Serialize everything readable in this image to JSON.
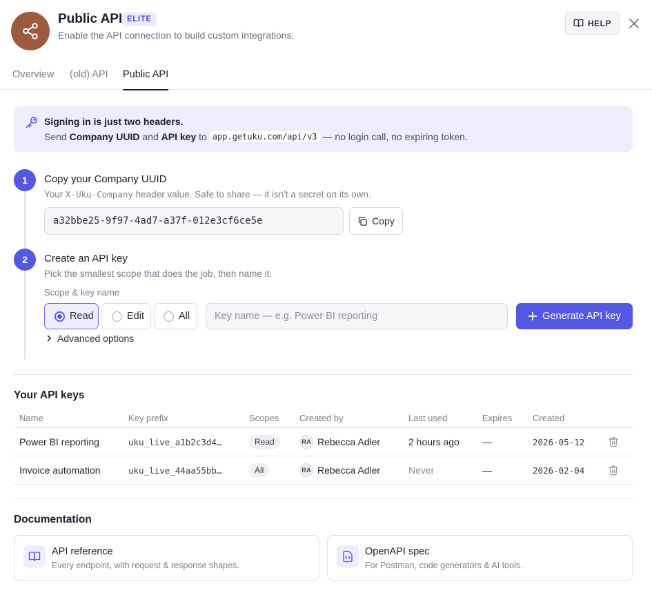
{
  "header": {
    "title": "Public API",
    "tier_badge": "ELITE",
    "subtitle": "Enable the API connection to build custom integrations.",
    "help_label": "HELP",
    "avatar_icon": "share-icon",
    "avatar_color": "#9c5b3f"
  },
  "tabs": [
    {
      "label": "Overview",
      "active": false
    },
    {
      "label": "(old) API",
      "active": false
    },
    {
      "label": "Public API",
      "active": true
    }
  ],
  "info": {
    "title": "Signing in is just two headers.",
    "line_prefix": "Send",
    "company_uuid": "Company UUID",
    "and": "and",
    "api_key": "API key",
    "to": "to",
    "endpoint": "app.getuku.com/api/v3",
    "suffix": "— no login call, no expiring token."
  },
  "step1": {
    "number": "1",
    "title": "Copy your Company UUID",
    "desc_prefix": "Your",
    "header_name": "X-Uku-Company",
    "desc_suffix": "header value. Safe to share — it isn't a secret on its own.",
    "uuid": "a32bbe25-9f97-4ad7-a37f-012e3cf6ce5e",
    "copy_label": "Copy"
  },
  "step2": {
    "number": "2",
    "title": "Create an API key",
    "desc": "Pick the smallest scope that does the job, then name it.",
    "field_label": "Scope & key name",
    "scopes": [
      {
        "label": "Read",
        "selected": true
      },
      {
        "label": "Edit",
        "selected": false
      },
      {
        "label": "All",
        "selected": false
      }
    ],
    "key_name_placeholder": "Key name — e.g. Power BI reporting",
    "key_name_value": "",
    "generate_label": "Generate API key",
    "advanced_label": "Advanced options"
  },
  "keys": {
    "title": "Your API keys",
    "columns": [
      "Name",
      "Key prefix",
      "Scopes",
      "Created by",
      "Last used",
      "Expires",
      "Created"
    ],
    "rows": [
      {
        "name": "Power BI reporting",
        "prefix": "uku_live_a1b2c3d4…",
        "scope": "Read",
        "initials": "RA",
        "created_by": "Rebecca Adler",
        "last_used": "2 hours ago",
        "expires": "—",
        "created": "2026-05-12"
      },
      {
        "name": "Invoice automation",
        "prefix": "uku_live_44aa55bb…",
        "scope": "All",
        "initials": "RA",
        "created_by": "Rebecca Adler",
        "last_used": "Never",
        "expires": "—",
        "created": "2026-02-04"
      }
    ]
  },
  "docs": {
    "title": "Documentation",
    "cards": [
      {
        "title": "API reference",
        "desc": "Every endpoint, with request & response shapes.",
        "icon": "book-icon"
      },
      {
        "title": "OpenAPI spec",
        "desc": "For Postman, code generators & AI tools.",
        "icon": "code-file-icon"
      }
    ]
  },
  "colors": {
    "accent": "#5457e0",
    "accent_soft": "#ededfb"
  }
}
